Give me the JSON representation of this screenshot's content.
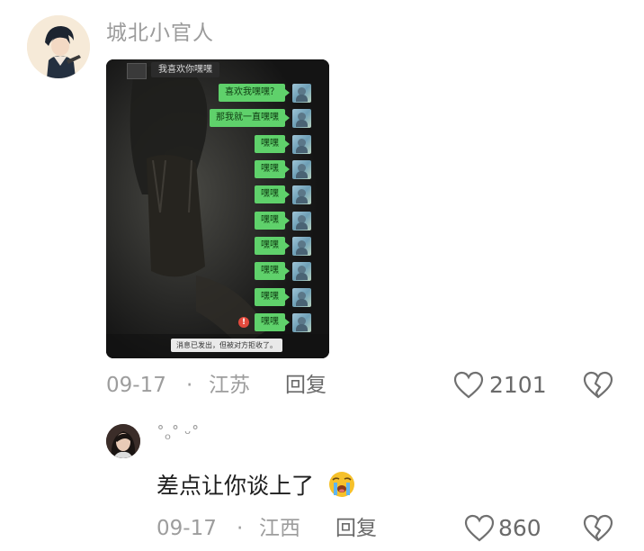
{
  "comments": [
    {
      "username": "城北小官人",
      "date": "09-17",
      "separator": "·",
      "location": "江苏",
      "reply_label": "回复",
      "like_count": "2101",
      "attachment": {
        "header_name": "我喜欢你嘿嘿",
        "messages": [
          "喜欢我嘿嘿？",
          "那我就一直嘿嘿",
          "嘿嘿",
          "嘿嘿",
          "嘿嘿",
          "嘿嘿",
          "嘿嘿",
          "嘿嘿",
          "嘿嘿",
          "嘿嘿"
        ],
        "failed_mark": "!",
        "notice": "消息已发出，但被对方拒收了。"
      }
    },
    {
      "username": "˚ₒ˚ ᵕ˚",
      "text": "差点让你谈上了",
      "emoji": "loudly-crying-face",
      "date": "09-17",
      "separator": "·",
      "location": "江西",
      "reply_label": "回复",
      "like_count": "860"
    }
  ],
  "colors": {
    "bubble_green": "#5fd16b",
    "meta_gray": "#9d9d9d"
  }
}
